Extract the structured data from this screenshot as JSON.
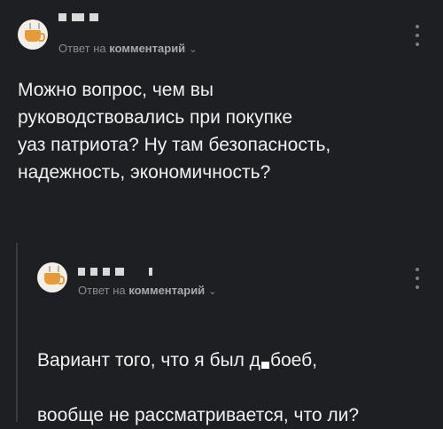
{
  "top_comment": {
    "avatar_icon": "coffee-cup-icon",
    "reply_prefix": "Ответ на",
    "reply_target": "комментарий",
    "chevron": "⌄",
    "menu_icon": "more-vertical-icon",
    "text": "Можно вопрос, чем вы\nруководствовались при покупке\nуаз патриота? Ну там безопасность,\nнадежность, экономичность?"
  },
  "reply_comment": {
    "avatar_icon": "coffee-cup-icon",
    "reply_prefix": "Ответ на",
    "reply_target": "комментарий",
    "chevron": "⌄",
    "menu_icon": "more-vertical-icon",
    "text_line1_before": "Вариант того, что я был д",
    "text_line1_after": "боеб,",
    "text_line2": "вообще не рассматривается, что ли?"
  },
  "colors": {
    "background": "#1e1f23",
    "text": "#f1f1f1",
    "meta": "#8a8b90",
    "thread_line": "#3a3b40"
  }
}
